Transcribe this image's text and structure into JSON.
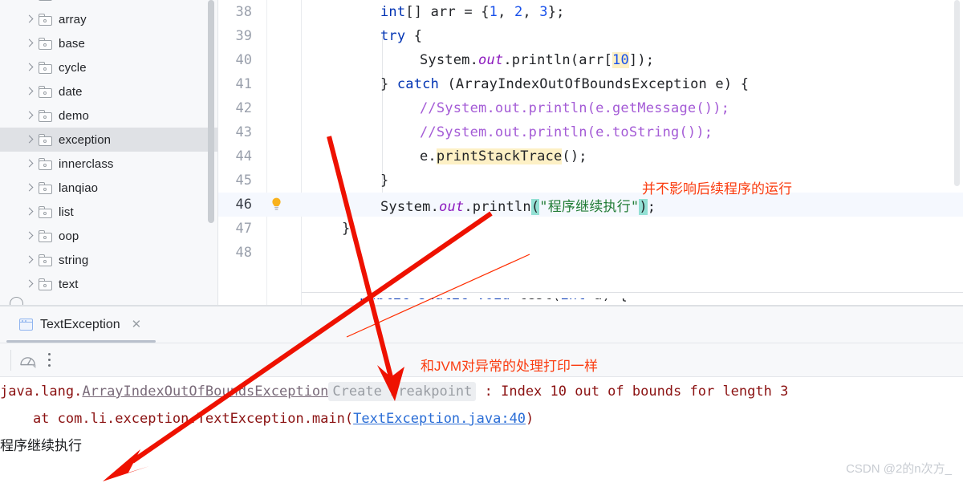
{
  "sidebar": {
    "scrollbar_present": true,
    "items": [
      {
        "label": "array",
        "selected": false
      },
      {
        "label": "base",
        "selected": false
      },
      {
        "label": "cycle",
        "selected": false
      },
      {
        "label": "date",
        "selected": false
      },
      {
        "label": "demo",
        "selected": false
      },
      {
        "label": "exception",
        "selected": true
      },
      {
        "label": "innerclass",
        "selected": false
      },
      {
        "label": "lanqiao",
        "selected": false
      },
      {
        "label": "list",
        "selected": false
      },
      {
        "label": "oop",
        "selected": false
      },
      {
        "label": "string",
        "selected": false
      },
      {
        "label": "text",
        "selected": false
      }
    ]
  },
  "editor": {
    "lines": [
      {
        "num": "38",
        "bulb": false,
        "active": false
      },
      {
        "num": "39",
        "bulb": false,
        "active": false
      },
      {
        "num": "40",
        "bulb": false,
        "active": false
      },
      {
        "num": "41",
        "bulb": false,
        "active": false
      },
      {
        "num": "42",
        "bulb": false,
        "active": false
      },
      {
        "num": "43",
        "bulb": false,
        "active": false
      },
      {
        "num": "44",
        "bulb": false,
        "active": false
      },
      {
        "num": "45",
        "bulb": false,
        "active": false
      },
      {
        "num": "46",
        "bulb": true,
        "active": true
      },
      {
        "num": "47",
        "bulb": false,
        "active": false
      },
      {
        "num": "48",
        "bulb": false,
        "active": false
      }
    ],
    "code": {
      "l38_kw_int": "int",
      "l38_a": "[] arr = {",
      "l38_n1": "1",
      "l38_c1": ", ",
      "l38_n2": "2",
      "l38_c2": ", ",
      "l38_n3": "3",
      "l38_end": "};",
      "l39_try": "try",
      "l39_brace": " {",
      "l40_a": "System.",
      "l40_out": "out",
      "l40_b": ".println(arr[",
      "l40_idx": "10",
      "l40_c": "]);",
      "l41_a": "} ",
      "l41_catch": "catch",
      "l41_b": " (ArrayIndexOutOfBoundsException e) {",
      "l42": "//System.out.println(e.getMessage());",
      "l43": "//System.out.println(e.toString());",
      "l44_a": "e.",
      "l44_hl": "printStackTrace",
      "l44_b": "();",
      "l45": "}",
      "l46_a": "System.",
      "l46_out": "out",
      "l46_b": ".println",
      "l46_paren_open": "(",
      "l46_str": "\"程序继续执行\"",
      "l46_paren_close": ")",
      "l46_semi": ";",
      "l47": "}"
    },
    "annotation_right": "并不影响后续程序的运行"
  },
  "run_window": {
    "tab_label": "TextException",
    "tab_close": "✕",
    "toolbar": {
      "profiler_icon": "profiler-gauge-icon",
      "more_icon": "more-vertical-icon"
    },
    "annotation": "和JVM对异常的处理打印一样",
    "console": {
      "line1_prefix": "java.lang.",
      "line1_link": "ArrayIndexOutOfBoundsException",
      "line1_chip": "Create breakpoint",
      "line1_rest": " : Index 10 out of bounds for length 3",
      "line2_prefix": "    at com.li.exception.TextException.main(",
      "line2_link": "TextException.java:40",
      "line2_suffix": ")",
      "line3": "程序继续执行"
    }
  },
  "watermark": "CSDN @2的n次方_",
  "colors": {
    "accent_red": "#fa3c10",
    "keyword_blue": "#0033b3",
    "comment_purple": "#a45bd6",
    "string_green": "#227c36",
    "highlight_yellow": "#fdf0c5",
    "bracket_teal": "#93e0d4",
    "exception_dark_red": "#8b1212",
    "selection_gray": "#dfe1e5"
  }
}
